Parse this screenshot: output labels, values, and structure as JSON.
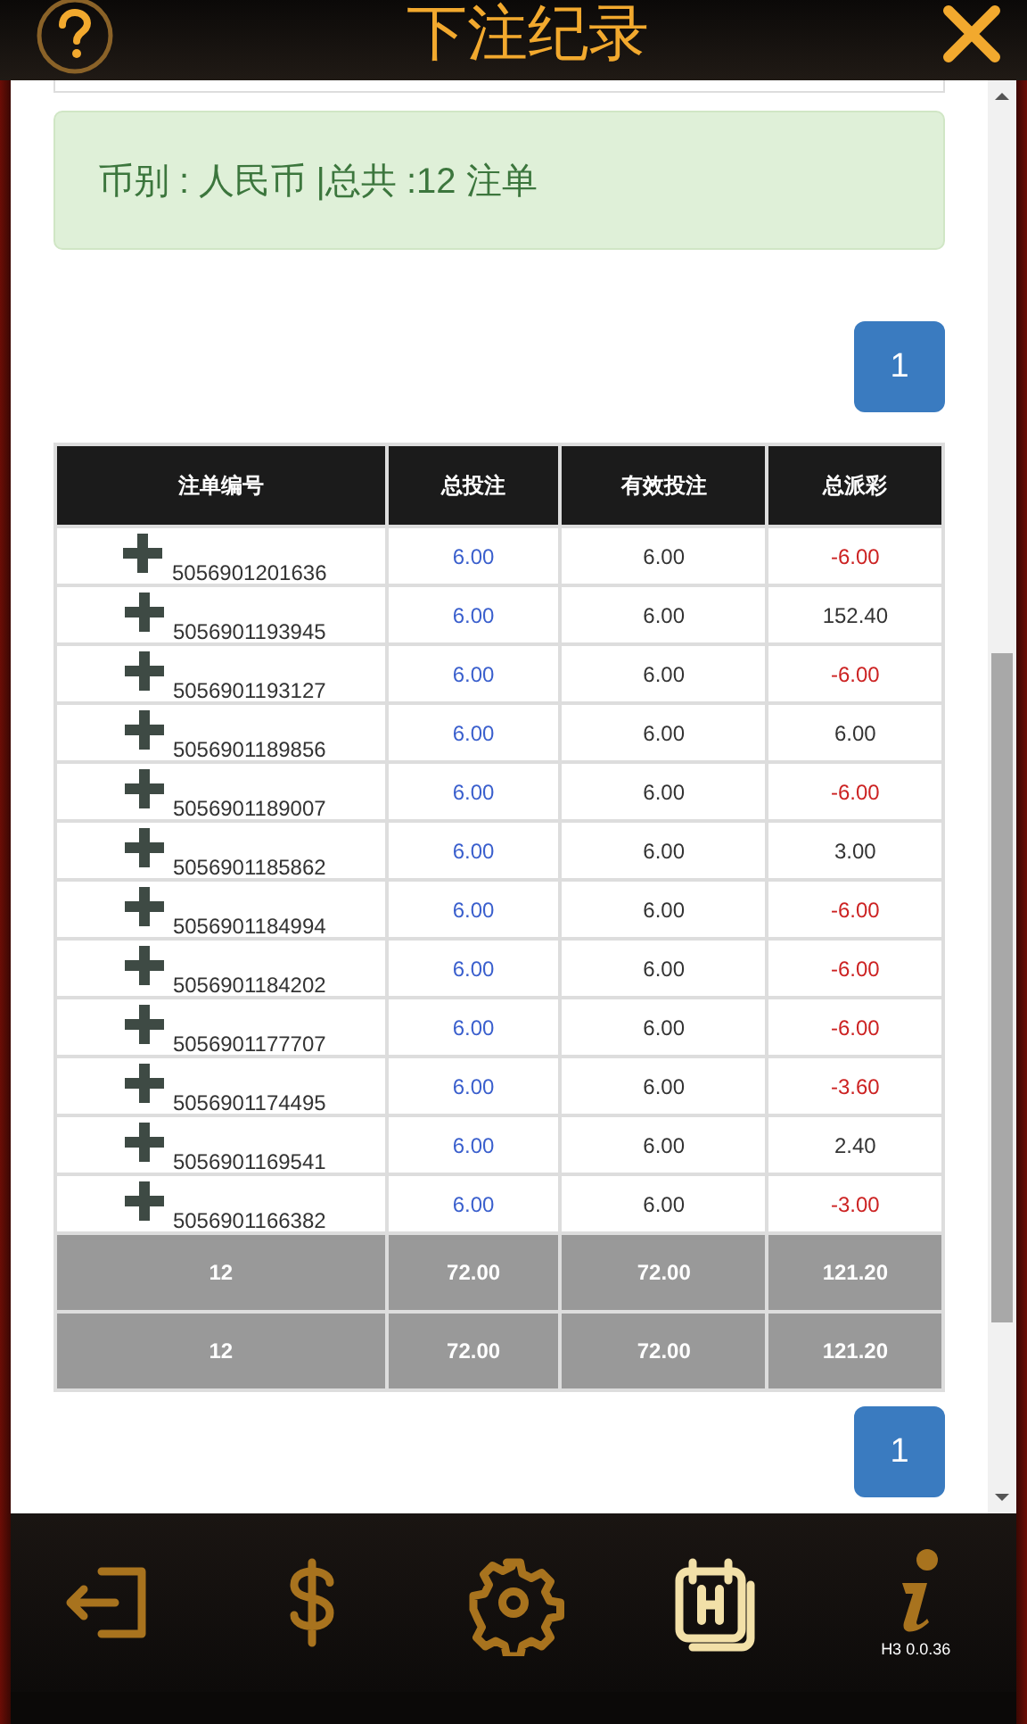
{
  "header": {
    "title": "下注纪录"
  },
  "summary": "币别 : 人民币 |总共 :12 注单",
  "pager_top": [
    {
      "label": "1",
      "selected": true
    }
  ],
  "table": {
    "columns": [
      "注单编号",
      "总投注",
      "有效投注",
      "总派彩"
    ],
    "rows": [
      {
        "id": "5056901201636",
        "total_bet": "6.00",
        "valid_bet": "6.00",
        "payout": "-6.00",
        "color": "#cc2222"
      },
      {
        "id": "5056901193945",
        "total_bet": "6.00",
        "valid_bet": "6.00",
        "payout": "152.40",
        "color": "#333333"
      },
      {
        "id": "5056901193127",
        "total_bet": "6.00",
        "valid_bet": "6.00",
        "payout": "-6.00",
        "color": "#cc2222"
      },
      {
        "id": "5056901189856",
        "total_bet": "6.00",
        "valid_bet": "6.00",
        "payout": "6.00",
        "color": "#333333"
      },
      {
        "id": "5056901189007",
        "total_bet": "6.00",
        "valid_bet": "6.00",
        "payout": "-6.00",
        "color": "#cc2222"
      },
      {
        "id": "5056901185862",
        "total_bet": "6.00",
        "valid_bet": "6.00",
        "payout": "3.00",
        "color": "#333333"
      },
      {
        "id": "5056901184994",
        "total_bet": "6.00",
        "valid_bet": "6.00",
        "payout": "-6.00",
        "color": "#cc2222"
      },
      {
        "id": "5056901184202",
        "total_bet": "6.00",
        "valid_bet": "6.00",
        "payout": "-6.00",
        "color": "#cc2222"
      },
      {
        "id": "5056901177707",
        "total_bet": "6.00",
        "valid_bet": "6.00",
        "payout": "-6.00",
        "color": "#cc2222"
      },
      {
        "id": "5056901174495",
        "total_bet": "6.00",
        "valid_bet": "6.00",
        "payout": "-3.60",
        "color": "#cc2222"
      },
      {
        "id": "5056901169541",
        "total_bet": "6.00",
        "valid_bet": "6.00",
        "payout": "2.40",
        "color": "#333333"
      },
      {
        "id": "5056901166382",
        "total_bet": "6.00",
        "valid_bet": "6.00",
        "payout": "-3.00",
        "color": "#cc2222"
      }
    ],
    "totals": [
      [
        "12",
        "72.00",
        "72.00",
        "121.20"
      ],
      [
        "12",
        "72.00",
        "72.00",
        "121.20"
      ]
    ]
  },
  "pager_bottom": [
    {
      "label": "1",
      "selected": true
    }
  ],
  "nav": [
    {
      "kind": "logout",
      "selected": false
    },
    {
      "kind": "dollar",
      "selected": false
    },
    {
      "kind": "settings",
      "selected": false
    },
    {
      "kind": "history",
      "selected": true
    },
    {
      "kind": "info",
      "selected": false,
      "caption": "H3 0.0.36"
    }
  ]
}
